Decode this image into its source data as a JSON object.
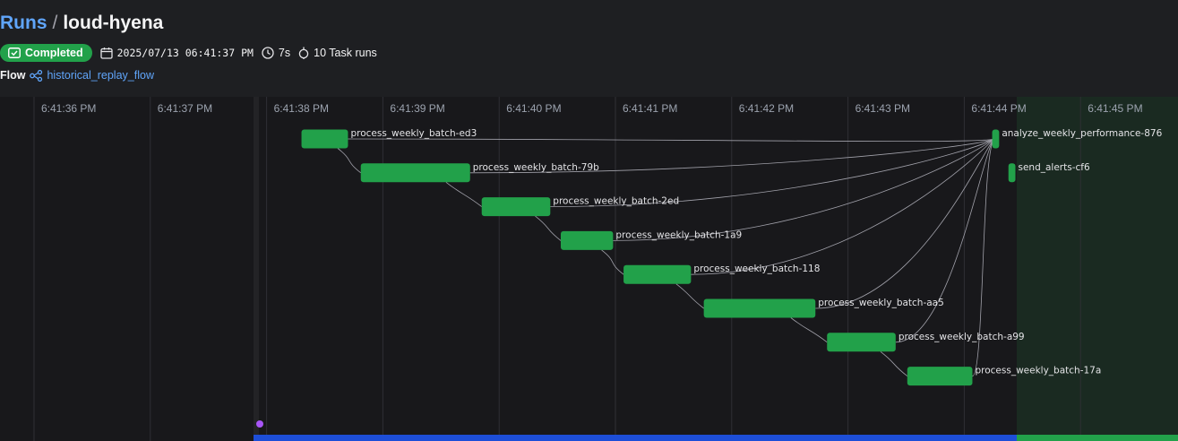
{
  "breadcrumb": {
    "root": "Runs",
    "separator": "/",
    "current": "loud-hyena"
  },
  "status": {
    "label": "Completed",
    "color": "#22a14a"
  },
  "meta": {
    "start_time": "2025/07/13 06:41:37 PM",
    "duration": "7s",
    "task_runs": "10 Task runs"
  },
  "flow": {
    "label": "Flow",
    "name": "historical_replay_flow"
  },
  "icons": {
    "status": "check-square-icon",
    "calendar": "calendar-icon",
    "duration": "clock-icon",
    "task_runs": "task-runs-icon",
    "flow": "flow-icon"
  },
  "timeline": {
    "ticks": [
      "6:41:36 PM",
      "6:41:37 PM",
      "6:41:38 PM",
      "6:41:39 PM",
      "6:41:40 PM",
      "6:41:41 PM",
      "6:41:42 PM",
      "6:41:43 PM",
      "6:41:44 PM",
      "6:41:45 PM"
    ],
    "bar_color": "#22a14a",
    "tasks": [
      {
        "name": "process_weekly_batch-ed3",
        "start_s": 38.3,
        "end_s": 38.7,
        "row": 0
      },
      {
        "name": "process_weekly_batch-79b",
        "start_s": 38.81,
        "end_s": 39.75,
        "row": 1
      },
      {
        "name": "process_weekly_batch-2ed",
        "start_s": 39.85,
        "end_s": 40.44,
        "row": 2
      },
      {
        "name": "process_weekly_batch-1a9",
        "start_s": 40.53,
        "end_s": 40.98,
        "row": 3
      },
      {
        "name": "process_weekly_batch-118",
        "start_s": 41.07,
        "end_s": 41.65,
        "row": 4
      },
      {
        "name": "process_weekly_batch-aa5",
        "start_s": 41.76,
        "end_s": 42.72,
        "row": 5
      },
      {
        "name": "process_weekly_batch-a99",
        "start_s": 42.82,
        "end_s": 43.41,
        "row": 6
      },
      {
        "name": "process_weekly_batch-17a",
        "start_s": 43.51,
        "end_s": 44.07,
        "row": 7
      },
      {
        "name": "analyze_weekly_performance-876",
        "start_s": 44.24,
        "end_s": 44.3,
        "row": 0
      },
      {
        "name": "send_alerts-cf6",
        "start_s": 44.38,
        "end_s": 44.44,
        "row": 1
      }
    ],
    "chain": [
      0,
      1,
      2,
      3,
      4,
      5,
      6,
      7
    ],
    "analysis_index": 8
  }
}
